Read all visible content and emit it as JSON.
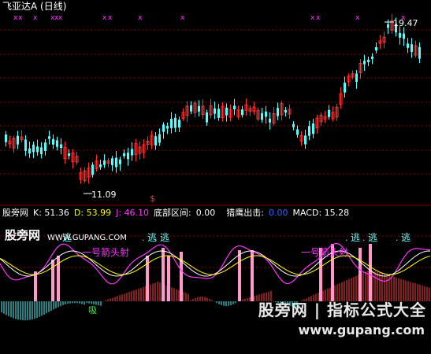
{
  "title": "飞亚达A (日线)",
  "top_marks": {
    "symbol": "x",
    "color": "#ff33ff"
  },
  "price_labels": {
    "high": "19.47",
    "low": "11.09",
    "signal": "$"
  },
  "indicator_bar": {
    "name": "股旁网",
    "k": "K: 51.36",
    "d": "D: 53.99",
    "j": "J: 46.10",
    "bottom_zone_label": "底部区间:",
    "bottom_zone_value": "0.00",
    "eagle_label": "猎鹰出击:",
    "eagle_value": "0.00",
    "macd": "MACD: 15.28"
  },
  "lower_panel": {
    "brand": "股旁网",
    "url": "WWW.GUPANG.COM",
    "escape_label": "逃",
    "fork_label_1": "一号箭头射",
    "fork_label_2": "一号箭头射",
    "absorb_label": "吸",
    "watermark_cn": "股旁网 | 指标公式大全",
    "watermark_url": "www.gupang.com"
  },
  "colors": {
    "up_candle": "#ff3232",
    "down_candle": "#54ffff",
    "grid": "#8b0000",
    "k_line": "#ffffff",
    "d_line": "#ffff00",
    "j_line": "#ff33ff",
    "pos_bar": "#ff4040",
    "neg_bar": "#54ffff",
    "spike": "#ff99cc"
  }
}
